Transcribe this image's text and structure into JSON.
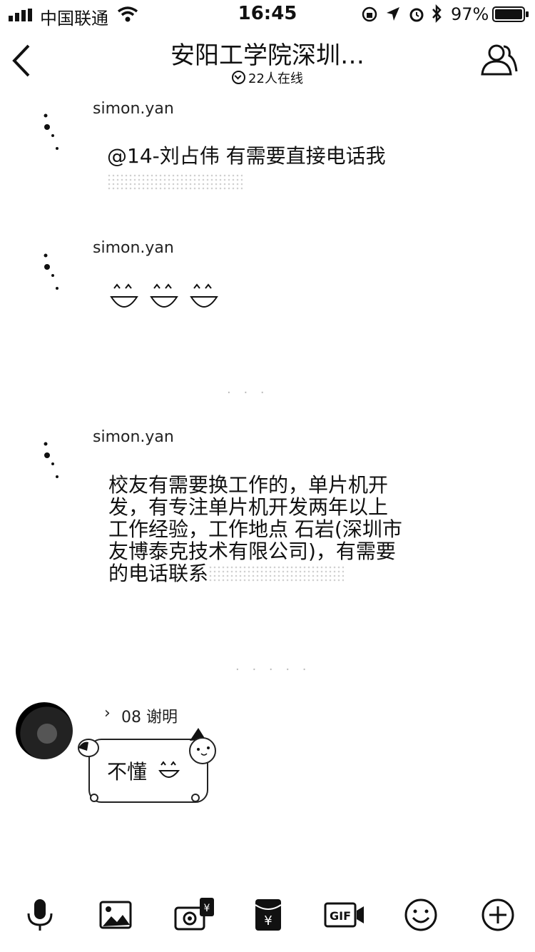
{
  "status_bar": {
    "carrier": "中国联通",
    "time": "16:45",
    "battery": "97%"
  },
  "nav": {
    "title": "安阳工学院深圳…",
    "online": "22人在线"
  },
  "messages": [
    {
      "sender": "simon.yan",
      "text": "@14-刘占伟 有需要直接电话我"
    },
    {
      "sender": "simon.yan"
    },
    {
      "sender": "simon.yan",
      "lines": [
        "校友有需要换工作的，单片机开",
        "发，有专注单片机开发两年以上",
        "工作经验，工作地点 石岩(深圳市",
        "友博泰克技术有限公司)，有需要",
        "的电话联系"
      ]
    },
    {
      "sender": "08 谢明",
      "text": "不懂"
    }
  ],
  "toolbar": {
    "icons": [
      "microphone-icon",
      "image-icon",
      "red-packet-camera-icon",
      "red-packet-icon",
      "gif-icon",
      "emoji-icon",
      "plus-icon"
    ]
  }
}
